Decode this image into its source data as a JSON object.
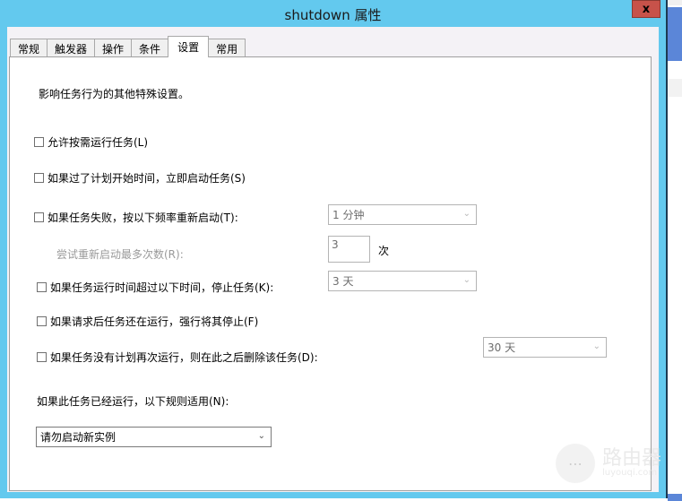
{
  "window": {
    "title": "shutdown 属性",
    "close_label": "x"
  },
  "tabs": [
    {
      "label": "常规",
      "active": false
    },
    {
      "label": "触发器",
      "active": false
    },
    {
      "label": "操作",
      "active": false
    },
    {
      "label": "条件",
      "active": false
    },
    {
      "label": "设置",
      "active": true
    },
    {
      "label": "常用",
      "active": false
    }
  ],
  "settings": {
    "description": "影响任务行为的其他特殊设置。",
    "allow_on_demand": {
      "label": "允许按需运行任务(L)",
      "checked": false
    },
    "run_if_missed": {
      "label": "如果过了计划开始时间，立即启动任务(S)",
      "checked": false
    },
    "restart_on_failure": {
      "label": "如果任务失败，按以下频率重新启动(T):",
      "checked": false,
      "interval_value": "1 分钟"
    },
    "restart_attempts": {
      "label": "尝试重新启动最多次数(R):",
      "value": "3",
      "unit": "次"
    },
    "stop_if_runs_longer": {
      "label": "如果任务运行时间超过以下时间，停止任务(K):",
      "checked": false,
      "duration_value": "3 天"
    },
    "force_stop": {
      "label": "如果请求后任务还在运行，强行将其停止(F)",
      "checked": false
    },
    "delete_if_not_scheduled": {
      "label": "如果任务没有计划再次运行，则在此之后删除该任务(D):",
      "checked": false,
      "after_value": "30 天"
    },
    "running_rule": {
      "label": "如果此任务已经运行，以下规则适用(N):",
      "value": "请勿启动新实例"
    }
  },
  "watermark": {
    "title": "路由器",
    "subtitle": "luyouqi.com"
  }
}
